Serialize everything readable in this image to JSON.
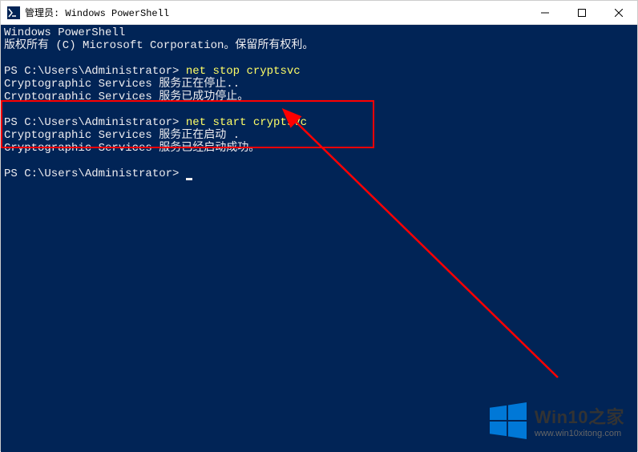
{
  "window": {
    "title": "管理员: Windows PowerShell"
  },
  "terminal": {
    "header1": "Windows PowerShell",
    "header2": "版权所有 (C) Microsoft Corporation。保留所有权利。",
    "prompt1": "PS C:\\Users\\Administrator> ",
    "cmd1": "net stop cryptsvc",
    "out1": "Cryptographic Services 服务正在停止..",
    "out2": "Cryptographic Services 服务已成功停止。",
    "prompt2": "PS C:\\Users\\Administrator> ",
    "cmd2": "net start cryptsvc",
    "out3": "Cryptographic Services 服务正在启动 .",
    "out4": "Cryptographic Services 服务已经启动成功。",
    "prompt3": "PS C:\\Users\\Administrator> "
  },
  "watermark": {
    "title": "Win10之家",
    "url": "www.win10xitong.com"
  }
}
